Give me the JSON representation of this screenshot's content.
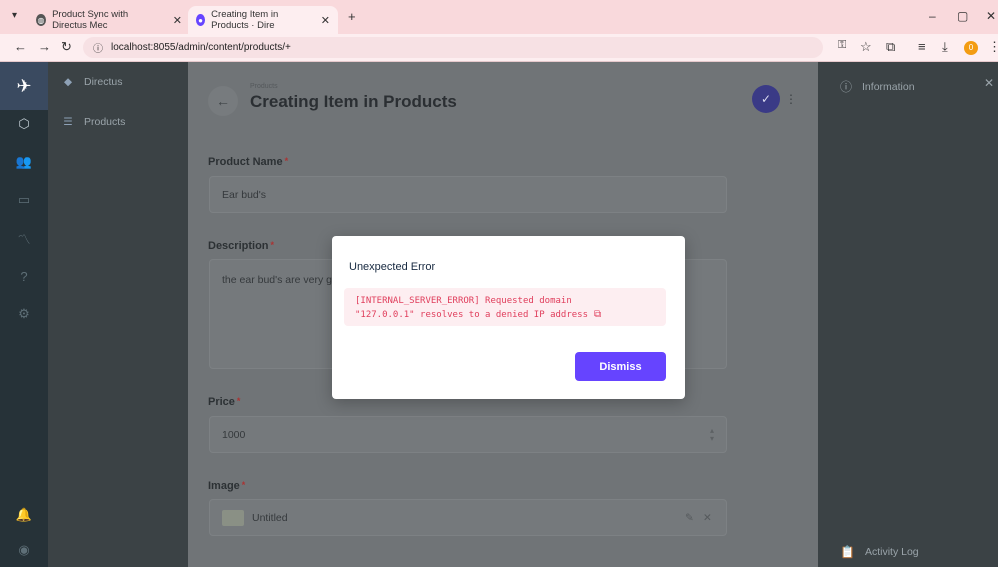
{
  "browser": {
    "tabs": [
      {
        "title": "Product Sync with Directus Mec",
        "active": false
      },
      {
        "title": "Creating Item in Products · Dire",
        "active": true
      }
    ],
    "new_tab": "+",
    "url": "localhost:8055/admin/content/products/+"
  },
  "app": {
    "project_name": "Directus",
    "nav_items": [
      {
        "label": "Products"
      }
    ],
    "header": {
      "breadcrumb": "Products",
      "title": "Creating Item in Products"
    },
    "fields": {
      "product_name": {
        "label": "Product Name",
        "required": "*",
        "value": "Ear bud's"
      },
      "description": {
        "label": "Description",
        "required": "*",
        "value": "the ear bud's are very g"
      },
      "price": {
        "label": "Price",
        "required": "*",
        "value": "1000"
      },
      "image": {
        "label": "Image",
        "required": "*",
        "value": "Untitled"
      }
    },
    "sidebar_right": {
      "information": "Information",
      "activity_log": "Activity Log"
    }
  },
  "dialog": {
    "title": "Unexpected Error",
    "error_line1": "[INTERNAL_SERVER_ERROR] Requested domain",
    "error_line2": "\"127.0.0.1\" resolves to a denied IP address",
    "button": "Dismiss"
  },
  "colors": {
    "accent": "#6644ff",
    "error_text": "#e03e5c",
    "error_bg": "#fdeef1"
  },
  "extensions_badge": "0"
}
